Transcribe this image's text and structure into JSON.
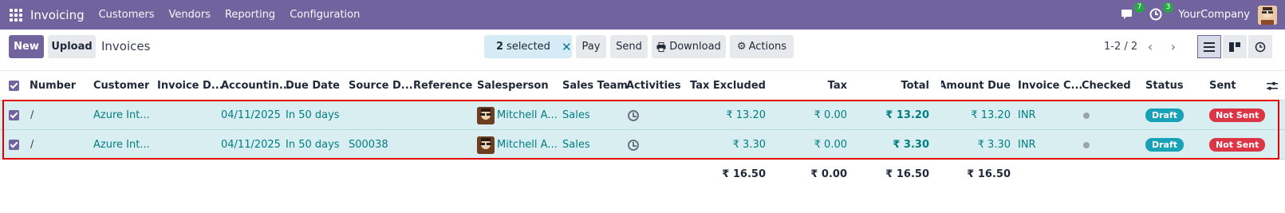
{
  "navbar": {
    "app_name": "Invoicing",
    "menu": [
      "Customers",
      "Vendors",
      "Reporting",
      "Configuration"
    ],
    "messages_count": "7",
    "activities_count": "3",
    "company": "YourCompany"
  },
  "control": {
    "new_label": "New",
    "upload_label": "Upload",
    "title": "Invoices",
    "selected_count": "2",
    "selected_label": "selected",
    "pay_label": "Pay",
    "send_label": "Send",
    "download_label": "Download",
    "actions_label": "Actions",
    "pager": "1-2 / 2"
  },
  "columns": {
    "number": "Number",
    "customer": "Customer",
    "invoice_date": "Invoice D...",
    "accounting_date": "Accountin...",
    "due_date": "Due Date",
    "source_doc": "Source D...",
    "reference": "Reference",
    "salesperson": "Salesperson",
    "sales_team": "Sales Team",
    "activities": "Activities",
    "tax_excluded": "Tax Excluded",
    "tax": "Tax",
    "total": "Total",
    "amount_due": "Amount Due",
    "invoice_currency": "Invoice C...",
    "checked": "Checked",
    "status": "Status",
    "sent": "Sent"
  },
  "rows": [
    {
      "number": "/",
      "customer": "Azure Int...",
      "invoice_date": "",
      "accounting_date": "04/11/2025",
      "due_date": "In 50 days",
      "source_doc": "",
      "reference": "",
      "salesperson": "Mitchell A...",
      "sales_team": "Sales",
      "tax_excluded": "₹ 13.20",
      "tax": "₹ 0.00",
      "total": "₹ 13.20",
      "amount_due": "₹ 13.20",
      "invoice_currency": "INR",
      "status": "Draft",
      "sent": "Not Sent"
    },
    {
      "number": "/",
      "customer": "Azure Int...",
      "invoice_date": "",
      "accounting_date": "04/11/2025",
      "due_date": "In 50 days",
      "source_doc": "S00038",
      "reference": "",
      "salesperson": "Mitchell A...",
      "sales_team": "Sales",
      "tax_excluded": "₹ 3.30",
      "tax": "₹ 0.00",
      "total": "₹ 3.30",
      "amount_due": "₹ 3.30",
      "invoice_currency": "INR",
      "status": "Draft",
      "sent": "Not Sent"
    }
  ],
  "totals": {
    "tax_excluded": "₹ 16.50",
    "tax": "₹ 0.00",
    "total": "₹ 16.50",
    "amount_due": "₹ 16.50"
  },
  "colors": {
    "brand": "#71639e",
    "link": "#017e84",
    "selected_row": "#d9eef1",
    "draft": "#17a2b8",
    "not_sent": "#dc3545"
  }
}
